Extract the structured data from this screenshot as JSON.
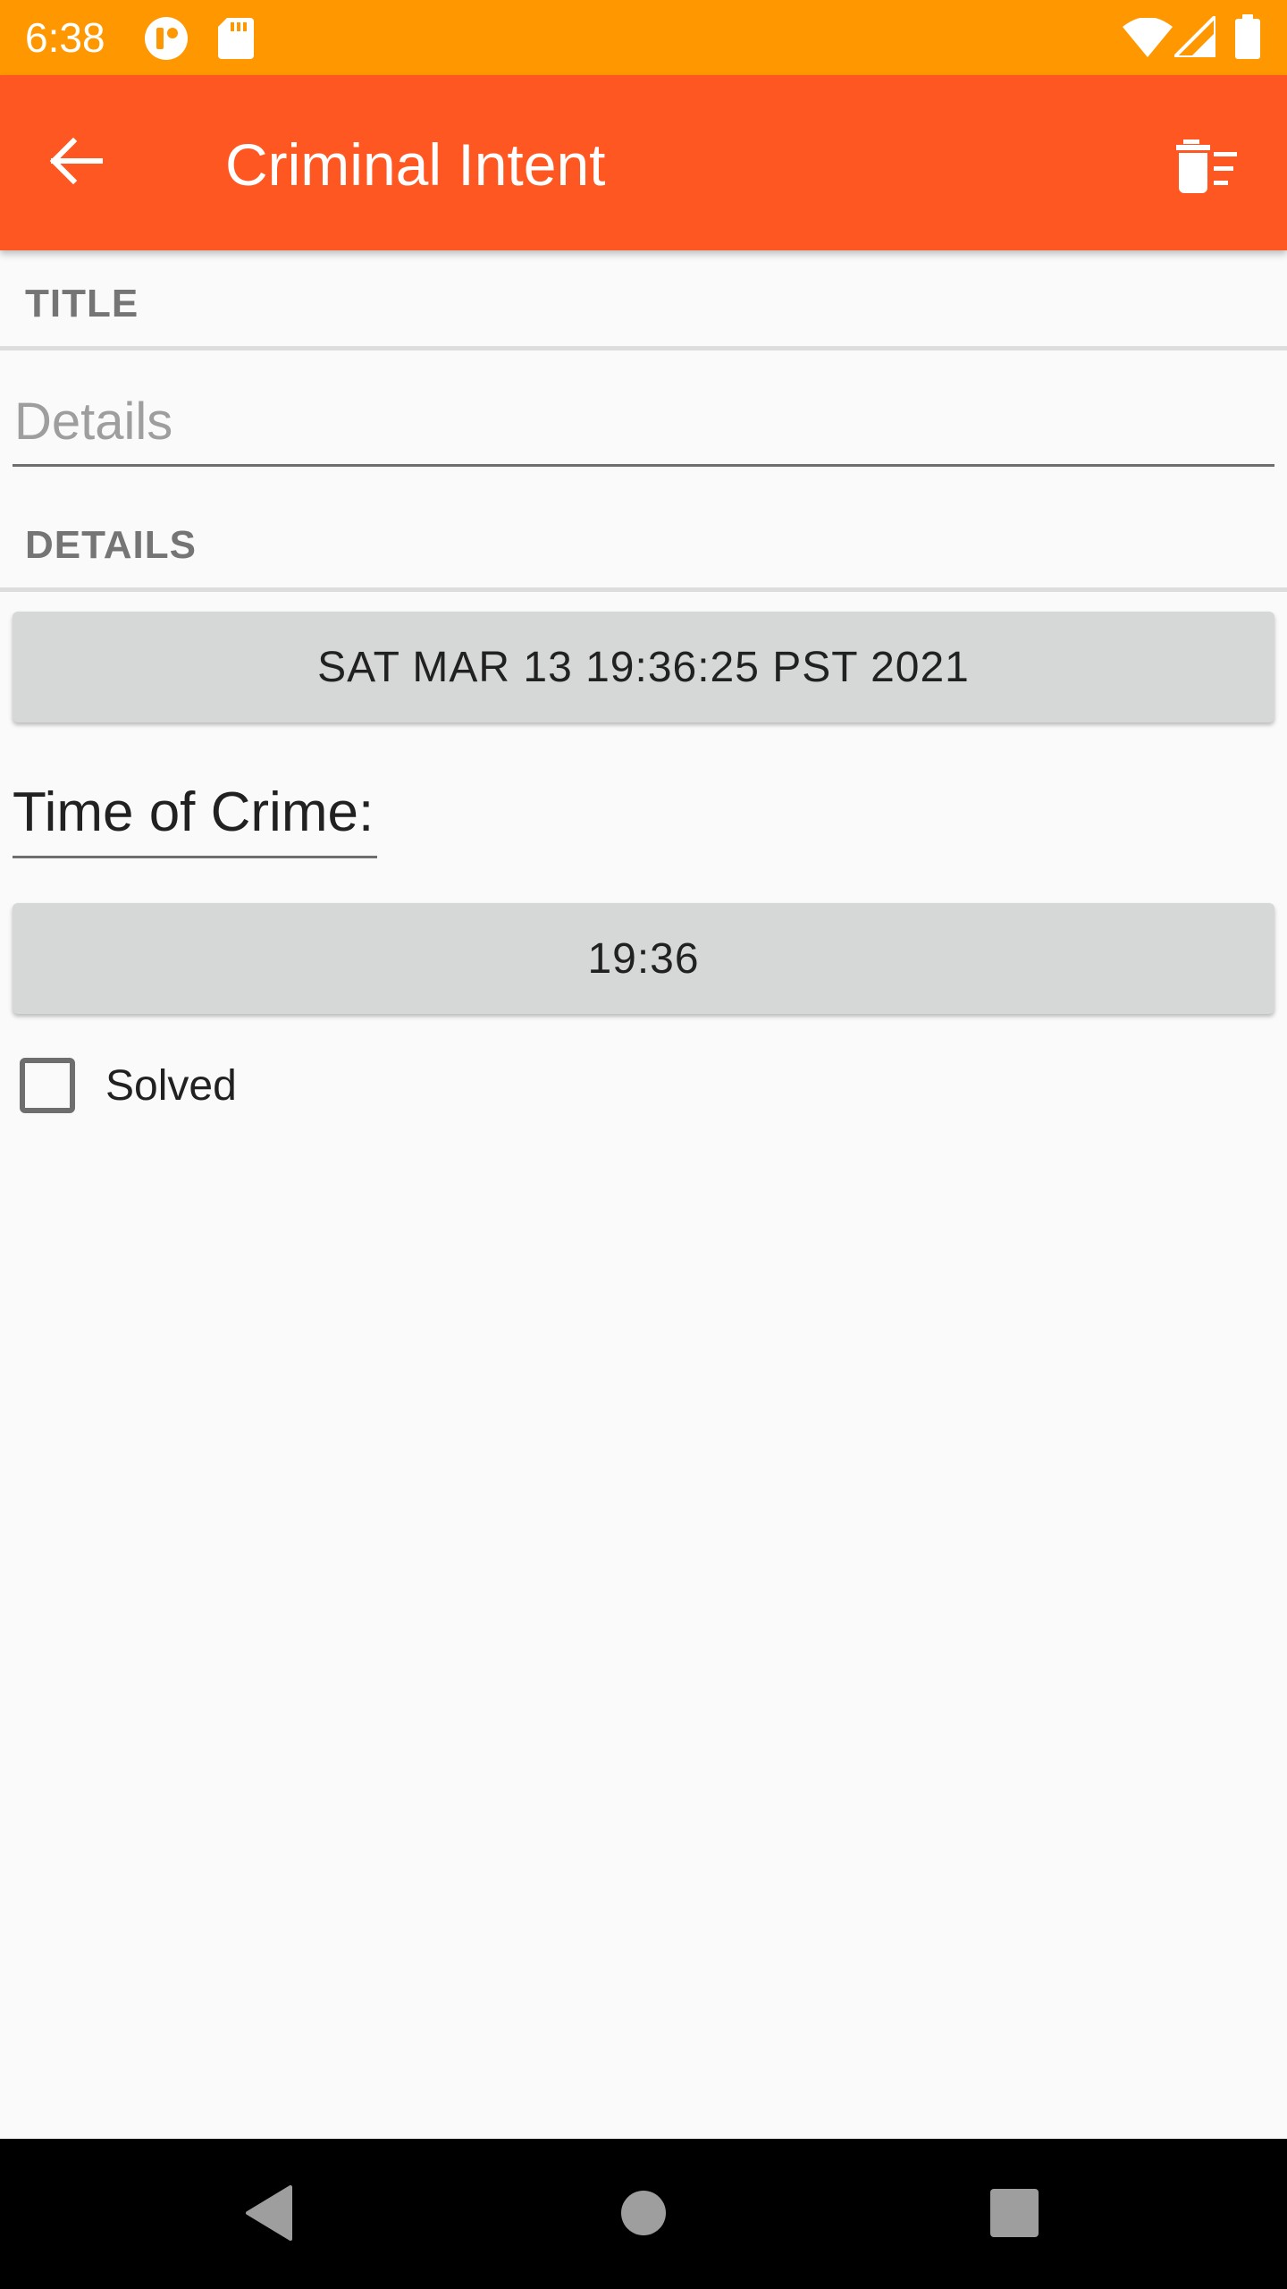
{
  "status_bar": {
    "time": "6:38",
    "icons": [
      "notification-app-icon",
      "sd-card-icon",
      "wifi-icon",
      "signal-icon",
      "battery-icon"
    ]
  },
  "app_bar": {
    "title": "Criminal Intent",
    "back_icon": "arrow-back-icon",
    "delete_icon": "delete-sweep-icon",
    "background": "#ff5722"
  },
  "form": {
    "title_header": "TITLE",
    "details_placeholder": "Details",
    "details_value": "",
    "details_header": "DETAILS",
    "date_button_label": "SAT MAR 13 19:36:25 PST 2021",
    "time_label": "Time of Crime:",
    "time_button_label": "19:36",
    "solved_label": "Solved",
    "solved_checked": false
  },
  "nav_bar": {
    "icons": [
      "back-triangle-icon",
      "home-circle-icon",
      "recents-square-icon"
    ]
  },
  "colors": {
    "status_bar": "#ff9800",
    "app_bar": "#ff5722",
    "button": "#d6d7d7",
    "background": "#fafafa"
  }
}
